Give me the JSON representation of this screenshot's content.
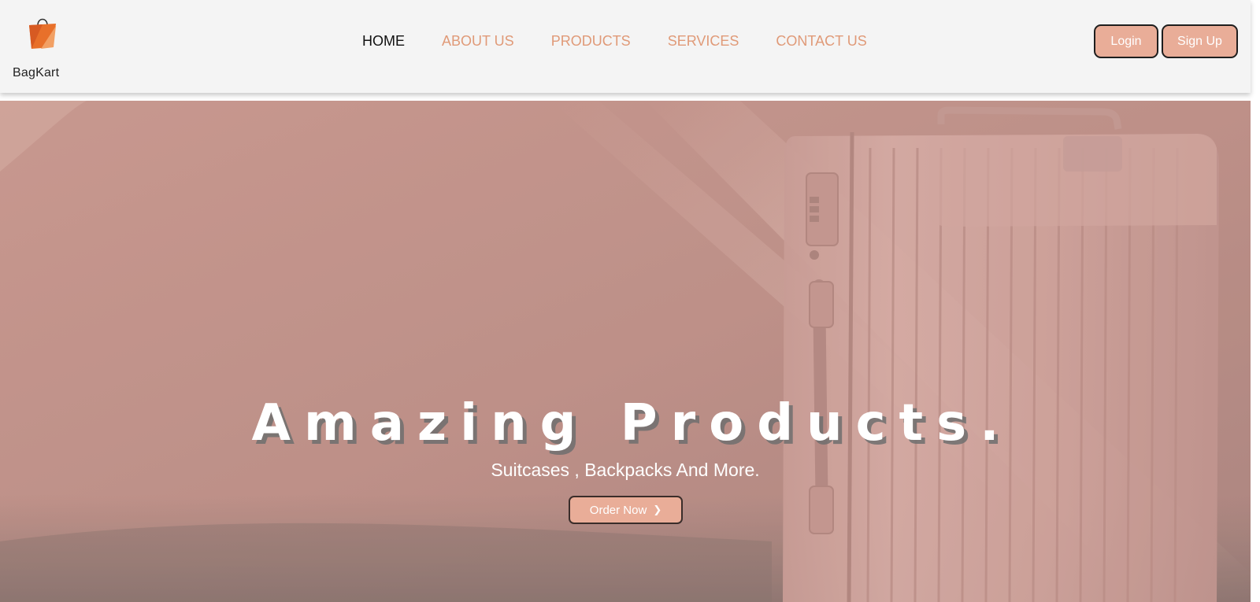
{
  "brand": {
    "name": "BagKart",
    "logo_icon": "shopping-bag-icon",
    "accent": "#e09a78"
  },
  "nav": {
    "items": [
      {
        "label": "HOME",
        "active": true
      },
      {
        "label": "ABOUT US",
        "active": false
      },
      {
        "label": "PRODUCTS",
        "active": false
      },
      {
        "label": "SERVICES",
        "active": false
      },
      {
        "label": "CONTACT US",
        "active": false
      }
    ]
  },
  "auth": {
    "login_label": "Login",
    "signup_label": "Sign Up",
    "button_color": "#e9ad98"
  },
  "hero": {
    "title": "Amazing Products.",
    "subtitle": "Suitcases , Backpacks And More.",
    "cta_label": "Order Now",
    "cta_icon": "chevron-right-icon",
    "background_image": "suitcase-photo"
  }
}
